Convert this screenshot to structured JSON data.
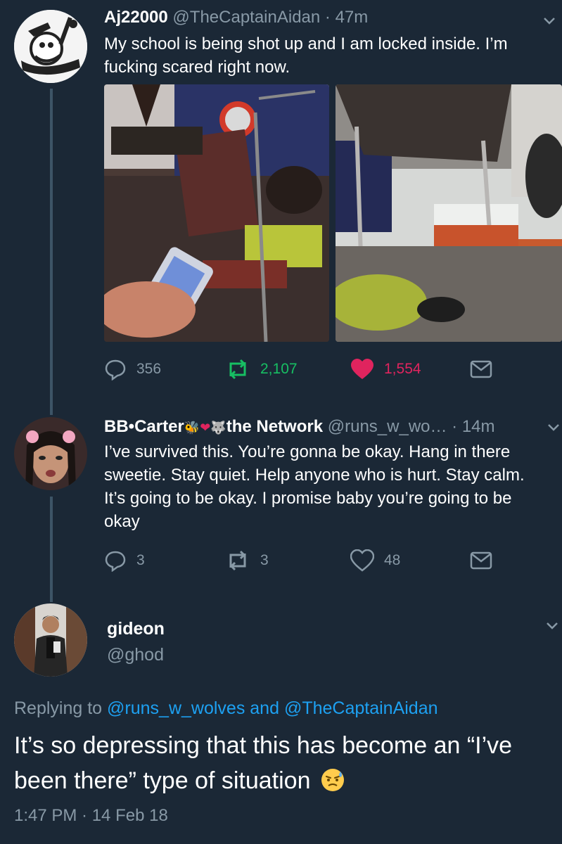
{
  "thread": {
    "tweet1": {
      "name": "Aj22000",
      "meta": "@TheCaptainAidan · 47m",
      "text": "My school is being shot up and I am locked inside. I’m fucking scared right now.",
      "replies": "356",
      "retweets": "2,107",
      "likes": "1,554",
      "retweet_color": "#17bf63",
      "like_color": "#e0245e"
    },
    "tweet2": {
      "name": "BB•Carter",
      "name_suffix": "the Network",
      "meta": "@runs_w_wo… · 14m",
      "text": "I’ve survived this. You’re gonna be okay. Hang in there sweetie. Stay quiet. Help anyone who is hurt. Stay calm. It’s going to be okay. I promise baby you’re going to be okay",
      "replies": "3",
      "retweets": "3",
      "likes": "48"
    }
  },
  "focused": {
    "name": "gideon",
    "handle": "@ghod",
    "replying_prefix": "Replying to",
    "mention1": "@runs_w_wolves",
    "and": "and",
    "mention2": "@TheCaptainAidan",
    "text": "It’s so depressing that this has become an “I’ve been there” type of situation",
    "timestamp": "1:47 PM · 14 Feb 18"
  },
  "icons": {
    "reply": "reply-icon",
    "retweet": "retweet-icon",
    "like": "heart-icon",
    "dm": "envelope-icon",
    "more": "chevron-down-icon",
    "emoji": "grimacing-sweat-emoji"
  },
  "colors": {
    "background": "#1b2836",
    "secondary_text": "#8899a6",
    "link": "#1da1f2"
  }
}
